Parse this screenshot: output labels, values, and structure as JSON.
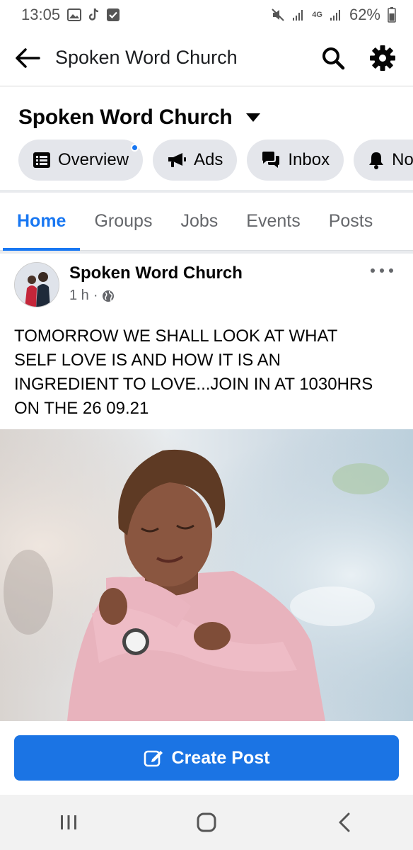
{
  "status_bar": {
    "time": "13:05",
    "network": "4G",
    "battery": "62%",
    "icons": [
      "image-icon",
      "tiktok-icon",
      "check-icon",
      "mute-icon",
      "signal-icon",
      "battery-icon"
    ]
  },
  "app_bar": {
    "title": "Spoken Word Church",
    "icons": [
      "back-arrow-icon",
      "search-icon",
      "gear-icon"
    ]
  },
  "page_header": {
    "name": "Spoken Word Church",
    "pills": [
      {
        "label": "Overview",
        "icon": "list-icon",
        "has_dot": true
      },
      {
        "label": "Ads",
        "icon": "megaphone-icon"
      },
      {
        "label": "Inbox",
        "icon": "chat-icon"
      },
      {
        "label": "Not",
        "icon": "bell-icon"
      }
    ]
  },
  "tabs": [
    {
      "label": "Home",
      "active": true
    },
    {
      "label": "Groups"
    },
    {
      "label": "Jobs"
    },
    {
      "label": "Events"
    },
    {
      "label": "Posts"
    }
  ],
  "post": {
    "author": "Spoken Word Church",
    "time": "1 h",
    "separator": "·",
    "text": "TOMORROW WE SHALL LOOK AT WHAT SELF LOVE IS AND HOW IT IS AN INGREDIENT TO LOVE...JOIN IN AT 1030HRS ON THE 26 09.21"
  },
  "create_post": {
    "label": "Create Post"
  },
  "colors": {
    "accent": "#1877f2",
    "button": "#1b74e4",
    "pill_bg": "#e4e6eb",
    "muted_text": "#65676b"
  }
}
